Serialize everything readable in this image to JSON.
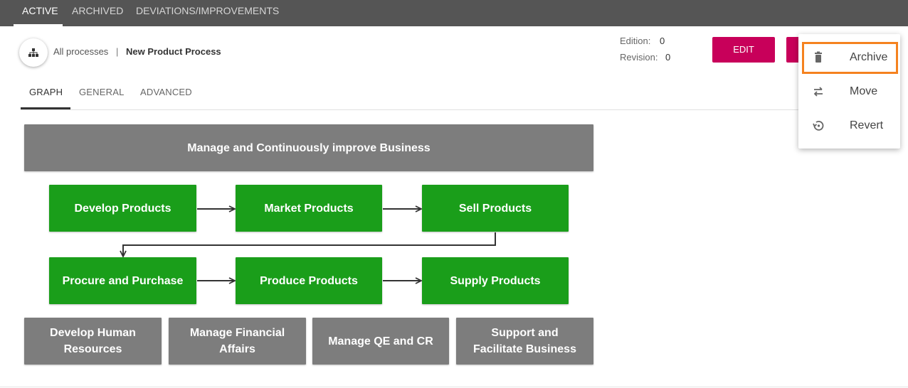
{
  "top_tabs": [
    {
      "label": "ACTIVE",
      "active": true
    },
    {
      "label": "ARCHIVED",
      "active": false
    },
    {
      "label": "DEVIATIONS/IMPROVEMENTS",
      "active": false
    }
  ],
  "breadcrumb": {
    "icon": "hierarchy-icon",
    "root": "All processes",
    "separator": "|",
    "current": "New Product Process"
  },
  "meta": {
    "edition_label": "Edition:",
    "edition_value": "0",
    "revision_label": "Revision:",
    "revision_value": "0"
  },
  "actions": {
    "edit_label": "EDIT"
  },
  "sub_tabs": [
    {
      "label": "GRAPH",
      "active": true
    },
    {
      "label": "GENERAL",
      "active": false
    },
    {
      "label": "ADVANCED",
      "active": false
    }
  ],
  "graph": {
    "top": "Manage and Continuously improve Business",
    "row1": [
      "Develop Products",
      "Market Products",
      "Sell Products"
    ],
    "row2": [
      "Procure and Purchase",
      "Produce Products",
      "Supply Products"
    ],
    "bottom": [
      "Develop Human Resources",
      "Manage Financial Affairs",
      "Manage QE and CR",
      "Support and Facilitate Business"
    ],
    "colors": {
      "support": "#7d7d7d",
      "core": "#1a9e1a"
    }
  },
  "menu": {
    "items": [
      {
        "label": "Archive",
        "icon": "trash-icon"
      },
      {
        "label": "Move",
        "icon": "swap-arrows-icon"
      },
      {
        "label": "Revert",
        "icon": "restore-icon"
      }
    ],
    "highlight_color": "#f5821f"
  },
  "colors": {
    "accent": "#c8005a",
    "topbar": "#555555"
  }
}
